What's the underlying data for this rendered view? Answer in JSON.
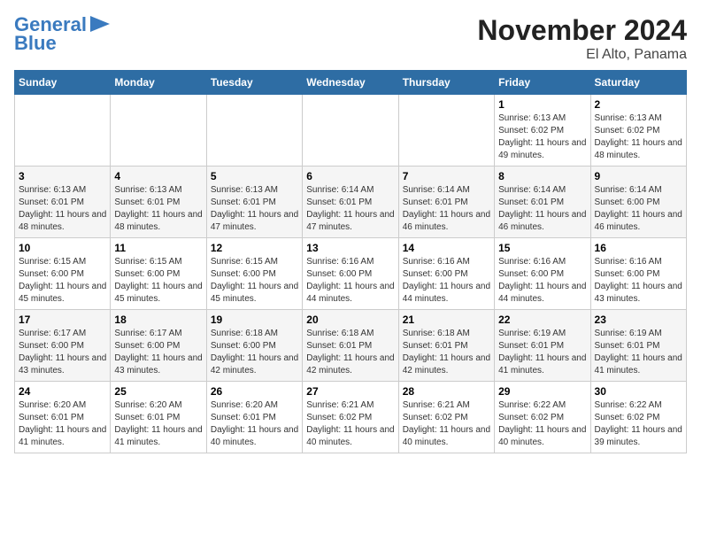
{
  "logo": {
    "line1": "General",
    "line2": "Blue"
  },
  "title": "November 2024",
  "subtitle": "El Alto, Panama",
  "days_of_week": [
    "Sunday",
    "Monday",
    "Tuesday",
    "Wednesday",
    "Thursday",
    "Friday",
    "Saturday"
  ],
  "weeks": [
    [
      {
        "day": "",
        "info": ""
      },
      {
        "day": "",
        "info": ""
      },
      {
        "day": "",
        "info": ""
      },
      {
        "day": "",
        "info": ""
      },
      {
        "day": "",
        "info": ""
      },
      {
        "day": "1",
        "info": "Sunrise: 6:13 AM\nSunset: 6:02 PM\nDaylight: 11 hours and 49 minutes."
      },
      {
        "day": "2",
        "info": "Sunrise: 6:13 AM\nSunset: 6:02 PM\nDaylight: 11 hours and 48 minutes."
      }
    ],
    [
      {
        "day": "3",
        "info": "Sunrise: 6:13 AM\nSunset: 6:01 PM\nDaylight: 11 hours and 48 minutes."
      },
      {
        "day": "4",
        "info": "Sunrise: 6:13 AM\nSunset: 6:01 PM\nDaylight: 11 hours and 48 minutes."
      },
      {
        "day": "5",
        "info": "Sunrise: 6:13 AM\nSunset: 6:01 PM\nDaylight: 11 hours and 47 minutes."
      },
      {
        "day": "6",
        "info": "Sunrise: 6:14 AM\nSunset: 6:01 PM\nDaylight: 11 hours and 47 minutes."
      },
      {
        "day": "7",
        "info": "Sunrise: 6:14 AM\nSunset: 6:01 PM\nDaylight: 11 hours and 46 minutes."
      },
      {
        "day": "8",
        "info": "Sunrise: 6:14 AM\nSunset: 6:01 PM\nDaylight: 11 hours and 46 minutes."
      },
      {
        "day": "9",
        "info": "Sunrise: 6:14 AM\nSunset: 6:00 PM\nDaylight: 11 hours and 46 minutes."
      }
    ],
    [
      {
        "day": "10",
        "info": "Sunrise: 6:15 AM\nSunset: 6:00 PM\nDaylight: 11 hours and 45 minutes."
      },
      {
        "day": "11",
        "info": "Sunrise: 6:15 AM\nSunset: 6:00 PM\nDaylight: 11 hours and 45 minutes."
      },
      {
        "day": "12",
        "info": "Sunrise: 6:15 AM\nSunset: 6:00 PM\nDaylight: 11 hours and 45 minutes."
      },
      {
        "day": "13",
        "info": "Sunrise: 6:16 AM\nSunset: 6:00 PM\nDaylight: 11 hours and 44 minutes."
      },
      {
        "day": "14",
        "info": "Sunrise: 6:16 AM\nSunset: 6:00 PM\nDaylight: 11 hours and 44 minutes."
      },
      {
        "day": "15",
        "info": "Sunrise: 6:16 AM\nSunset: 6:00 PM\nDaylight: 11 hours and 44 minutes."
      },
      {
        "day": "16",
        "info": "Sunrise: 6:16 AM\nSunset: 6:00 PM\nDaylight: 11 hours and 43 minutes."
      }
    ],
    [
      {
        "day": "17",
        "info": "Sunrise: 6:17 AM\nSunset: 6:00 PM\nDaylight: 11 hours and 43 minutes."
      },
      {
        "day": "18",
        "info": "Sunrise: 6:17 AM\nSunset: 6:00 PM\nDaylight: 11 hours and 43 minutes."
      },
      {
        "day": "19",
        "info": "Sunrise: 6:18 AM\nSunset: 6:00 PM\nDaylight: 11 hours and 42 minutes."
      },
      {
        "day": "20",
        "info": "Sunrise: 6:18 AM\nSunset: 6:01 PM\nDaylight: 11 hours and 42 minutes."
      },
      {
        "day": "21",
        "info": "Sunrise: 6:18 AM\nSunset: 6:01 PM\nDaylight: 11 hours and 42 minutes."
      },
      {
        "day": "22",
        "info": "Sunrise: 6:19 AM\nSunset: 6:01 PM\nDaylight: 11 hours and 41 minutes."
      },
      {
        "day": "23",
        "info": "Sunrise: 6:19 AM\nSunset: 6:01 PM\nDaylight: 11 hours and 41 minutes."
      }
    ],
    [
      {
        "day": "24",
        "info": "Sunrise: 6:20 AM\nSunset: 6:01 PM\nDaylight: 11 hours and 41 minutes."
      },
      {
        "day": "25",
        "info": "Sunrise: 6:20 AM\nSunset: 6:01 PM\nDaylight: 11 hours and 41 minutes."
      },
      {
        "day": "26",
        "info": "Sunrise: 6:20 AM\nSunset: 6:01 PM\nDaylight: 11 hours and 40 minutes."
      },
      {
        "day": "27",
        "info": "Sunrise: 6:21 AM\nSunset: 6:02 PM\nDaylight: 11 hours and 40 minutes."
      },
      {
        "day": "28",
        "info": "Sunrise: 6:21 AM\nSunset: 6:02 PM\nDaylight: 11 hours and 40 minutes."
      },
      {
        "day": "29",
        "info": "Sunrise: 6:22 AM\nSunset: 6:02 PM\nDaylight: 11 hours and 40 minutes."
      },
      {
        "day": "30",
        "info": "Sunrise: 6:22 AM\nSunset: 6:02 PM\nDaylight: 11 hours and 39 minutes."
      }
    ]
  ]
}
